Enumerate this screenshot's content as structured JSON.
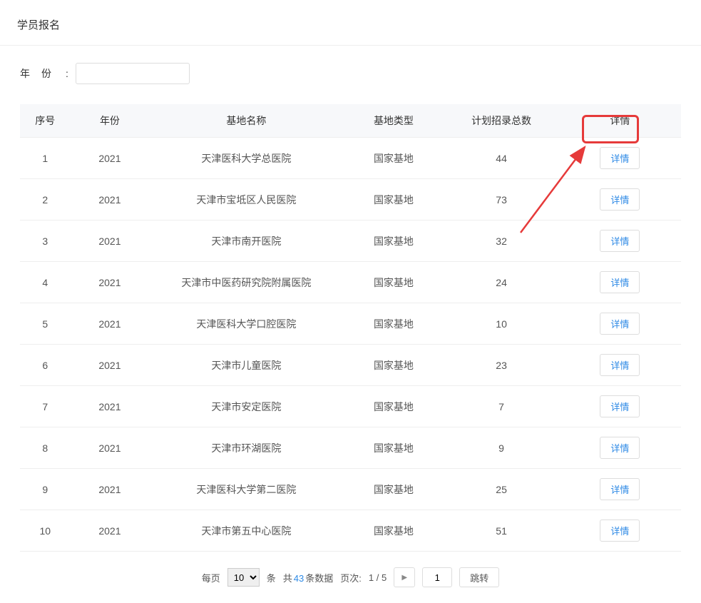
{
  "page_title": "学员报名",
  "filter": {
    "year_label": "年份",
    "year_value": ""
  },
  "table": {
    "headers": {
      "index": "序号",
      "year": "年份",
      "name": "基地名称",
      "type": "基地类型",
      "count": "计划招录总数",
      "action": "详情"
    },
    "action_label": "详情",
    "rows": [
      {
        "idx": "1",
        "year": "2021",
        "name": "天津医科大学总医院",
        "type": "国家基地",
        "count": "44"
      },
      {
        "idx": "2",
        "year": "2021",
        "name": "天津市宝坻区人民医院",
        "type": "国家基地",
        "count": "73"
      },
      {
        "idx": "3",
        "year": "2021",
        "name": "天津市南开医院",
        "type": "国家基地",
        "count": "32"
      },
      {
        "idx": "4",
        "year": "2021",
        "name": "天津市中医药研究院附属医院",
        "type": "国家基地",
        "count": "24"
      },
      {
        "idx": "5",
        "year": "2021",
        "name": "天津医科大学口腔医院",
        "type": "国家基地",
        "count": "10"
      },
      {
        "idx": "6",
        "year": "2021",
        "name": "天津市儿童医院",
        "type": "国家基地",
        "count": "23"
      },
      {
        "idx": "7",
        "year": "2021",
        "name": "天津市安定医院",
        "type": "国家基地",
        "count": "7"
      },
      {
        "idx": "8",
        "year": "2021",
        "name": "天津市环湖医院",
        "type": "国家基地",
        "count": "9"
      },
      {
        "idx": "9",
        "year": "2021",
        "name": "天津医科大学第二医院",
        "type": "国家基地",
        "count": "25"
      },
      {
        "idx": "10",
        "year": "2021",
        "name": "天津市第五中心医院",
        "type": "国家基地",
        "count": "51"
      }
    ]
  },
  "pagination": {
    "per_page_label": "每页",
    "per_page_value": "10",
    "unit_label": "条",
    "total_prefix": "共",
    "total_count": "43",
    "total_suffix": "条数据",
    "page_label": "页次:",
    "current_page": "1",
    "page_sep": "/",
    "total_pages": "5",
    "next_icon": "▶",
    "jump_input_value": "1",
    "jump_label": "跳转"
  }
}
